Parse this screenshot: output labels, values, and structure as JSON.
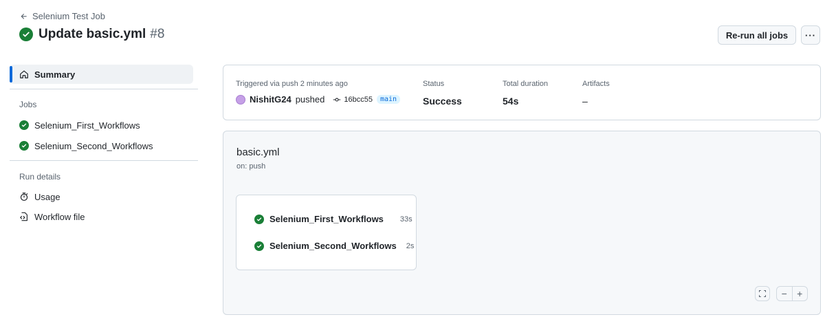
{
  "header": {
    "back_label": "Selenium Test Job",
    "title": "Update basic.yml",
    "run_number": "#8",
    "rerun_label": "Re-run all jobs",
    "more_label": "···"
  },
  "sidebar": {
    "summary_label": "Summary",
    "jobs_heading": "Jobs",
    "jobs": [
      {
        "label": "Selenium_First_Workflows",
        "status": "success"
      },
      {
        "label": "Selenium_Second_Workflows",
        "status": "success"
      }
    ],
    "run_details_heading": "Run details",
    "details": [
      {
        "label": "Usage",
        "icon": "stopwatch-icon"
      },
      {
        "label": "Workflow file",
        "icon": "file-code-icon"
      }
    ]
  },
  "summary": {
    "trigger_label": "Triggered via push 2 minutes ago",
    "actor": "NishitG24",
    "action": "pushed",
    "commit": "16bcc55",
    "branch": "main",
    "status_label": "Status",
    "status_value": "Success",
    "duration_label": "Total duration",
    "duration_value": "54s",
    "artifacts_label": "Artifacts",
    "artifacts_value": "–"
  },
  "graph": {
    "workflow_name": "basic.yml",
    "trigger": "on: push",
    "jobs": [
      {
        "label": "Selenium_First_Workflows",
        "duration": "33s"
      },
      {
        "label": "Selenium_Second_Workflows",
        "duration": "2s"
      }
    ],
    "zoom_out": "−",
    "zoom_in": "+"
  },
  "colors": {
    "success": "#1a7f37",
    "accent": "#0969da",
    "muted_text": "#59636e",
    "border": "#d1d9e0"
  }
}
